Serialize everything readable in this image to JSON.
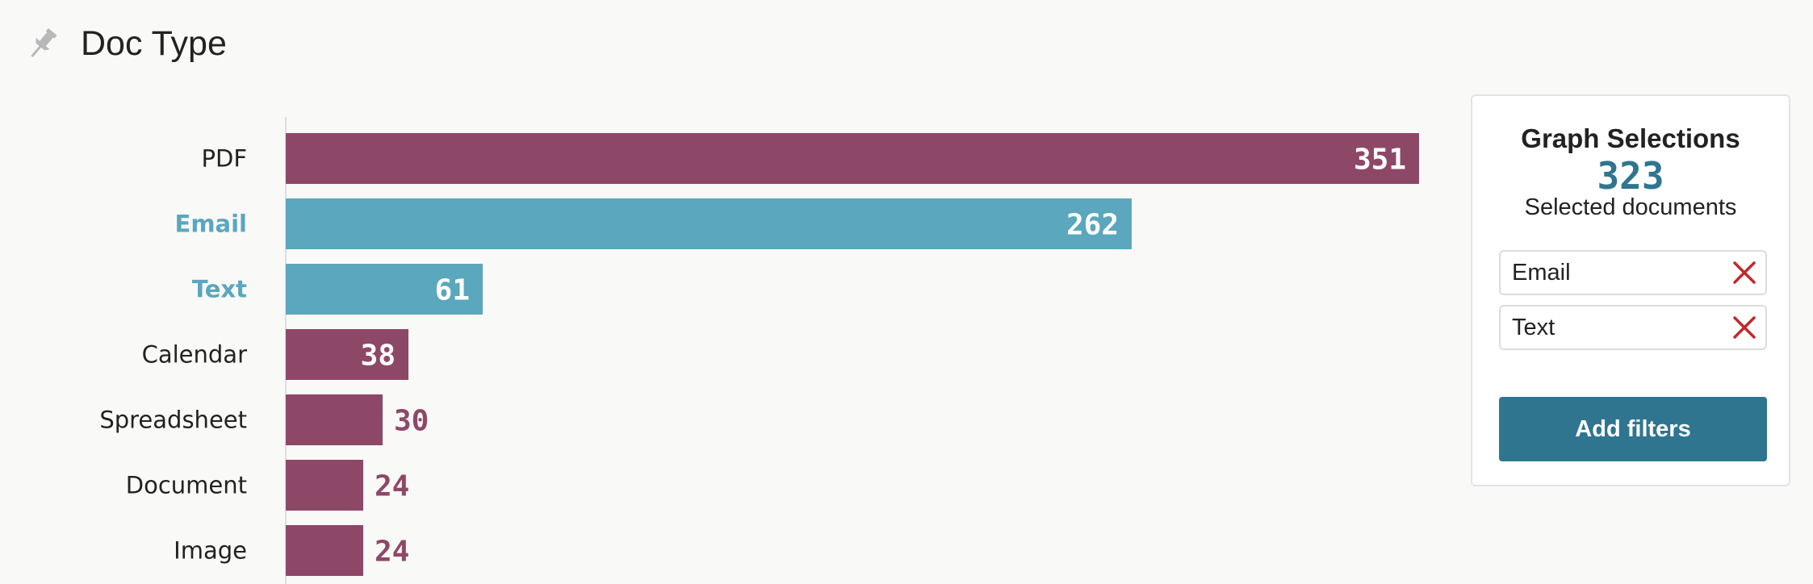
{
  "panel": {
    "title": "Doc Type",
    "pin_icon": "pin-icon"
  },
  "colors": {
    "bar_default": "#8e4867",
    "bar_selected": "#5aa7be",
    "accent": "#2f7590",
    "remove": "#c0282d"
  },
  "chart_data": {
    "type": "bar",
    "orientation": "horizontal",
    "categories": [
      "PDF",
      "Email",
      "Text",
      "Calendar",
      "Spreadsheet",
      "Document",
      "Image"
    ],
    "values": [
      351,
      262,
      61,
      38,
      30,
      24,
      24
    ],
    "selected": [
      false,
      true,
      true,
      false,
      false,
      false,
      false
    ],
    "title": "",
    "xlabel": "",
    "ylabel": "",
    "xlim": [
      0,
      351
    ],
    "grid": false,
    "legend": "none"
  },
  "selections": {
    "heading": "Graph Selections",
    "count": "323",
    "subtitle": "Selected documents",
    "chips": [
      {
        "label": "Email",
        "remove_icon": "close-icon"
      },
      {
        "label": "Text",
        "remove_icon": "close-icon"
      }
    ],
    "add_button": "Add filters"
  }
}
